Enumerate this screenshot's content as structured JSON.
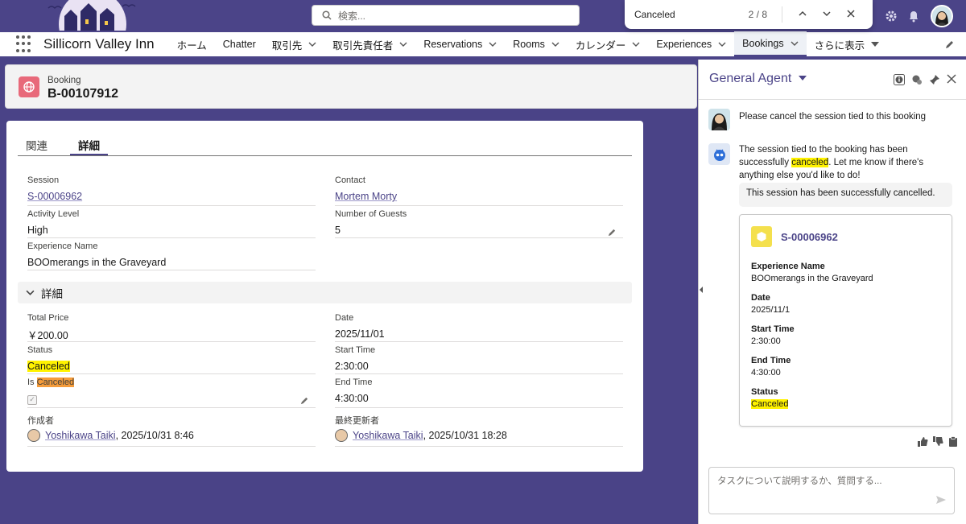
{
  "search": {
    "placeholder": "検索..."
  },
  "find_bar": {
    "query": "Canceled",
    "count": "2 / 8"
  },
  "nav": {
    "app_name": "Sillicorn Valley Inn",
    "items": [
      {
        "label": "ホーム",
        "chevron": false
      },
      {
        "label": "Chatter",
        "chevron": false
      },
      {
        "label": "取引先",
        "chevron": true
      },
      {
        "label": "取引先責任者",
        "chevron": true
      },
      {
        "label": "Reservations",
        "chevron": true
      },
      {
        "label": "Rooms",
        "chevron": true
      },
      {
        "label": "カレンダー",
        "chevron": true
      },
      {
        "label": "Experiences",
        "chevron": true
      },
      {
        "label": "Bookings",
        "chevron": true,
        "active": true
      },
      {
        "label": "さらに表示",
        "chevron": true
      }
    ]
  },
  "record": {
    "type": "Booking",
    "title": "B-00107912"
  },
  "tabs": [
    {
      "label": "関連"
    },
    {
      "label": "詳細"
    }
  ],
  "fields": {
    "session_label": "Session",
    "session_value": "S-00006962",
    "contact_label": "Contact",
    "contact_value": "Mortem Morty",
    "activity_label": "Activity Level",
    "activity_value": "High",
    "guests_label": "Number of Guests",
    "guests_value": "5",
    "exp_label": "Experience Name",
    "exp_value": "BOOmerangs in the Graveyard"
  },
  "section": {
    "title": "詳細"
  },
  "details": {
    "price_label": "Total Price",
    "price_value": "￥200.00",
    "date_label": "Date",
    "date_value": "2025/11/01",
    "status_label": "Status",
    "status_value": "Canceled",
    "start_label": "Start Time",
    "start_value": "2:30:00",
    "is_label_prefix": "Is ",
    "is_label_hl": "Canceled",
    "is_checked": true,
    "end_label": "End Time",
    "end_value": "4:30:00",
    "created_label": "作成者",
    "created_user": "Yoshikawa Taiki",
    "created_date": ", 2025/10/31 8:46",
    "modified_label": "最終更新者",
    "modified_user": "Yoshikawa Taiki",
    "modified_date": ", 2025/10/31 18:28"
  },
  "panel": {
    "title": "General Agent",
    "user_msg": "Please cancel the session tied to this booking",
    "agent_msg_1": "The session tied to the booking has been successfully ",
    "agent_msg_hl": "canceled",
    "agent_msg_2": ". Let me know if there's anything else you'd like to do!",
    "reply_box": "This session has been successfully cancelled.",
    "card": {
      "id": "S-00006962",
      "exp_label": "Experience Name",
      "exp_value": "BOOmerangs in the Graveyard",
      "date_label": "Date",
      "date_value": "2025/11/1",
      "start_label": "Start Time",
      "start_value": "2:30:00",
      "end_label": "End Time",
      "end_value": "4:30:00",
      "status_label": "Status",
      "status_value": "Canceled"
    },
    "input_placeholder": "タスクについて説明するか、質問する..."
  },
  "colors": {
    "brand": "#4b4488",
    "highlight": "#fff200",
    "highlight_active": "#f59c3b",
    "booking_icon": "#e8697a",
    "session_icon": "#f4e04d"
  }
}
